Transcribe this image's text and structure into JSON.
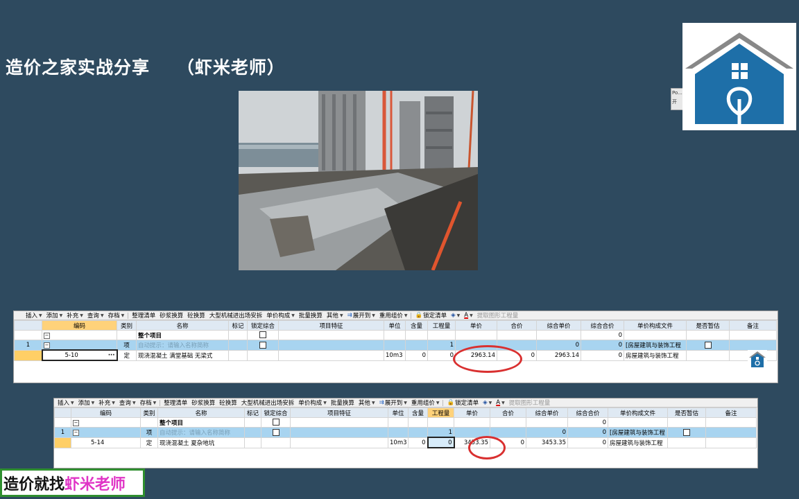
{
  "slide": {
    "title": "造价之家实战分享    （虾米老师）",
    "banner_prefix": "造价就找",
    "banner_highlight": "虾米老师"
  },
  "dialog": {
    "line1": "Po...",
    "line2": "开"
  },
  "toolbar": {
    "items": [
      "插入",
      "添加",
      "补充",
      "查询",
      "存档",
      "整理清单",
      "砂浆换算",
      "砼换算",
      "大型机械进出场安拆",
      "单价构成",
      "批量换算",
      "其他",
      "展开到",
      "重用组价",
      "锁定清单",
      "提取图形工程量"
    ]
  },
  "columns": [
    "编码",
    "类别",
    "名称",
    "标记",
    "锁定综合",
    "项目特征",
    "单位",
    "含量",
    "工程量",
    "单价",
    "合价",
    "综合单价",
    "综合合价",
    "单价构成文件",
    "是否暂估",
    "备注"
  ],
  "sheet1": {
    "row_whole": {
      "name": "整个项目",
      "total": "0"
    },
    "row_item": {
      "num": "1",
      "type": "项",
      "name": "自动提示：请输入名称简称",
      "qty": "1",
      "unit_price_total": "0",
      "total": "0",
      "file": "[房屋建筑与装饰工程"
    },
    "row_def": {
      "code": "5-10",
      "type": "定",
      "name": "现浇混凝土  满堂基础  无梁式",
      "unit": "10m3",
      "content": "0",
      "qty": "0",
      "price": "2963.14",
      "amount": "0",
      "comp_price": "2963.14",
      "comp_total": "0",
      "file": "房屋建筑与装饰工程"
    }
  },
  "sheet2": {
    "row_whole": {
      "name": "整个项目",
      "total": "0"
    },
    "row_item": {
      "num": "1",
      "type": "项",
      "name": "自动提示：请输入名称简称",
      "qty": "1",
      "unit_price_total": "0",
      "total": "0",
      "file": "[房屋建筑与装饰工程"
    },
    "row_def": {
      "code": "5-14",
      "type": "定",
      "name": "现浇混凝土  夏杂地坑",
      "unit": "10m3",
      "content": "0",
      "qty": "0",
      "price": "3453.35",
      "amount": "0",
      "comp_price": "3453.35",
      "comp_total": "0",
      "file": "房屋建筑与装饰工程"
    }
  },
  "colors": {
    "background": "#2e4a5f",
    "highlight_circle": "#d93030",
    "logo_blue": "#1e6fa8",
    "banner_pink": "#e034c6"
  }
}
